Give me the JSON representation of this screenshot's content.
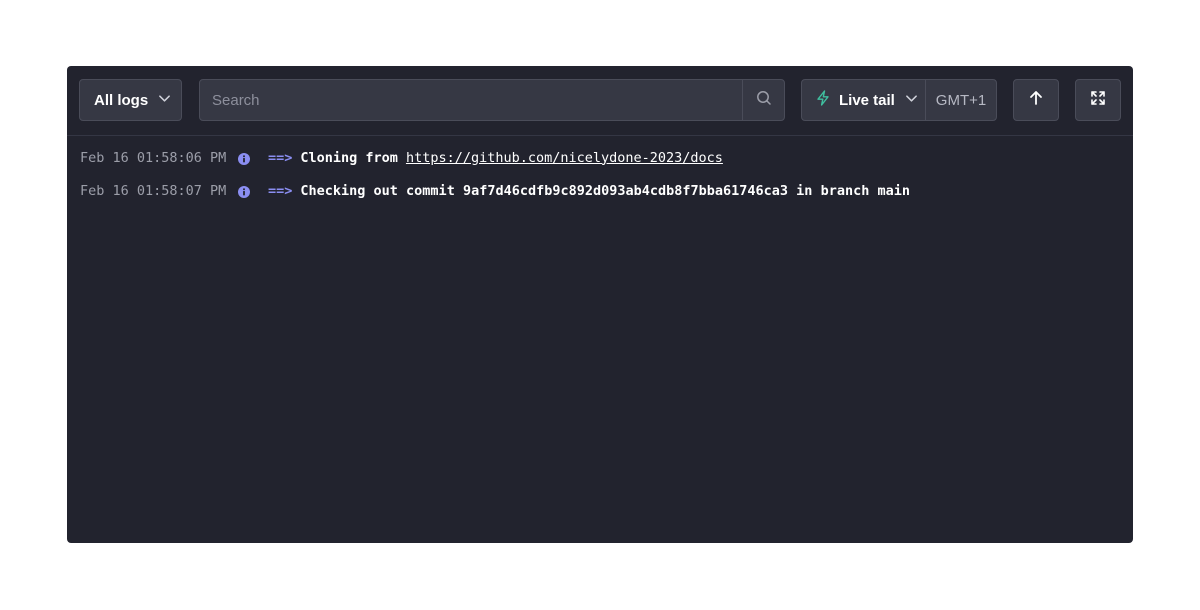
{
  "toolbar": {
    "log_filter": {
      "label": "All logs",
      "icon": "chevron-down-icon"
    },
    "search": {
      "placeholder": "Search",
      "value": "",
      "icon": "search-icon"
    },
    "live_tail": {
      "label": "Live tail",
      "icon": "lightning-icon",
      "accent": "#3fbf9f"
    },
    "timezone": "GMT+1",
    "scroll_top_icon": "arrow-up-icon",
    "fullscreen_icon": "expand-icon"
  },
  "logs": [
    {
      "timestamp": "Feb 16 01:58:06 PM",
      "level": "info",
      "arrow": "==>",
      "message": "Cloning from",
      "link": "https://github.com/nicelydone-2023/docs"
    },
    {
      "timestamp": "Feb 16 01:58:07 PM",
      "level": "info",
      "arrow": "==>",
      "message": "Checking out commit 9af7d46cdfb9c892d093ab4cdb8f7bba61746ca3 in branch main"
    }
  ],
  "colors": {
    "panel_bg": "#22232e",
    "control_bg": "#363844",
    "info": "#8b8ef2",
    "live_accent": "#3fbf9f"
  }
}
